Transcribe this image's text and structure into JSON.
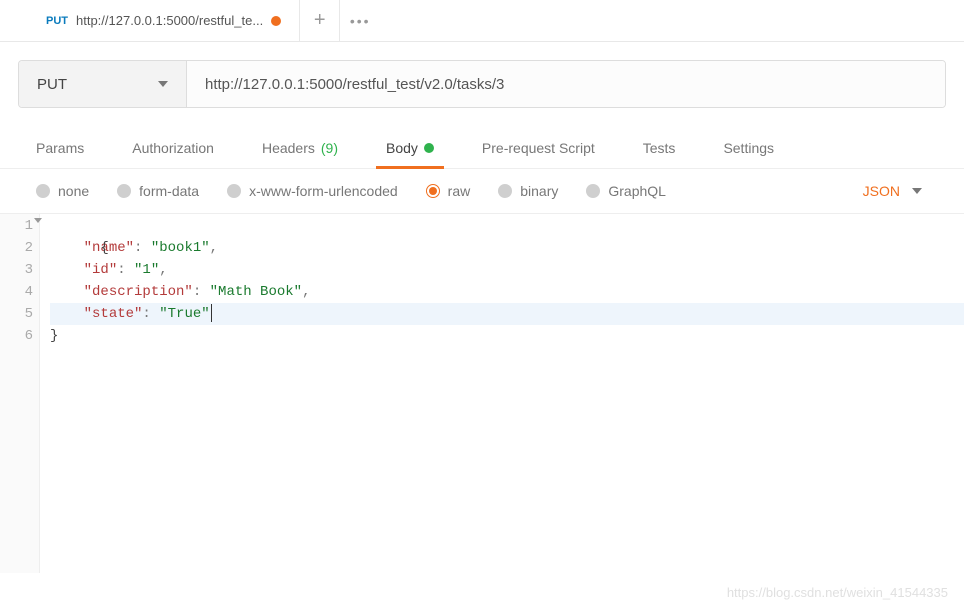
{
  "tab": {
    "method": "PUT",
    "title": "http://127.0.0.1:5000/restful_te..."
  },
  "request": {
    "method": "PUT",
    "url": "http://127.0.0.1:5000/restful_test/v2.0/tasks/3"
  },
  "request_tabs": {
    "params": "Params",
    "authorization": "Authorization",
    "headers_label": "Headers",
    "headers_count": "(9)",
    "body": "Body",
    "prerequest": "Pre-request Script",
    "tests": "Tests",
    "settings": "Settings"
  },
  "body_types": {
    "none": "none",
    "form_data": "form-data",
    "urlencoded": "x-www-form-urlencoded",
    "raw": "raw",
    "binary": "binary",
    "graphql": "GraphQL"
  },
  "format": "JSON",
  "code": {
    "line_numbers": [
      "1",
      "2",
      "3",
      "4",
      "5",
      "6"
    ],
    "l1_open": "{",
    "l2_k": "\"name\"",
    "l2_v": "\"book1\"",
    "l3_k": "\"id\"",
    "l3_v": "\"1\"",
    "l4_k": "\"description\"",
    "l4_v": "\"Math Book\"",
    "l5_k": "\"state\"",
    "l5_v": "\"True\"",
    "l6_close": "}"
  },
  "watermark": "https://blog.csdn.net/weixin_41544335"
}
